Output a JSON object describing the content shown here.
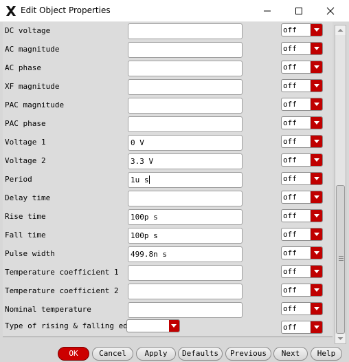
{
  "window": {
    "title": "Edit Object Properties"
  },
  "rows": [
    {
      "label": "DC voltage",
      "value": "",
      "select": "off"
    },
    {
      "label": "AC magnitude",
      "value": "",
      "select": "off"
    },
    {
      "label": "AC phase",
      "value": "",
      "select": "off"
    },
    {
      "label": "XF magnitude",
      "value": "",
      "select": "off"
    },
    {
      "label": "PAC magnitude",
      "value": "",
      "select": "off"
    },
    {
      "label": "PAC phase",
      "value": "",
      "select": "off"
    },
    {
      "label": "Voltage 1",
      "value": "0 V",
      "select": "off"
    },
    {
      "label": "Voltage 2",
      "value": "3.3 V",
      "select": "off"
    },
    {
      "label": "Period",
      "value": "1u s",
      "select": "off"
    },
    {
      "label": "Delay time",
      "value": "",
      "select": "off"
    },
    {
      "label": "Rise time",
      "value": "100p s",
      "select": "off"
    },
    {
      "label": "Fall time",
      "value": "100p s",
      "select": "off"
    },
    {
      "label": "Pulse width",
      "value": "499.8n s",
      "select": "off"
    },
    {
      "label": "Temperature coefficient 1",
      "value": "",
      "select": "off"
    },
    {
      "label": "Temperature coefficient 2",
      "value": "",
      "select": "off"
    },
    {
      "label": "Nominal temperature",
      "value": "",
      "select": "off"
    },
    {
      "label": "Type of rising & falling edge",
      "value": "",
      "select": "off"
    }
  ],
  "buttons": [
    {
      "label": "OK"
    },
    {
      "label": "Cancel"
    },
    {
      "label": "Apply"
    },
    {
      "label": "Defaults"
    },
    {
      "label": "Previous"
    },
    {
      "label": "Next"
    },
    {
      "label": "Help"
    }
  ],
  "colors": {
    "accent": "#cc0000",
    "panel": "#dcdcdc"
  },
  "icons": {
    "app": "x-logo-icon",
    "min": "minimize-icon",
    "max": "maximize-icon",
    "close": "close-icon"
  }
}
